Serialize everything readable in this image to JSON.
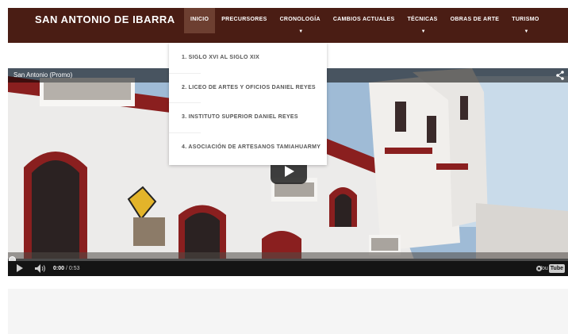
{
  "header": {
    "brand": "SAN ANTONIO DE IBARRA",
    "nav": [
      {
        "label": "INICIO",
        "active": true,
        "dropdown": false
      },
      {
        "label": "PRECURSORES",
        "active": false,
        "dropdown": false
      },
      {
        "label": "CRONOLOGÍA",
        "active": false,
        "dropdown": true
      },
      {
        "label": "CAMBIOS ACTUALES",
        "active": false,
        "dropdown": false
      },
      {
        "label": "TÉCNICAS",
        "active": false,
        "dropdown": true
      },
      {
        "label": "OBRAS DE ARTE",
        "active": false,
        "dropdown": false
      },
      {
        "label": "TURISMO",
        "active": false,
        "dropdown": true
      }
    ]
  },
  "dropdown": {
    "items": [
      "1. SIGLO XVI AL SIGLO XIX",
      "2. LICEO DE ARTES Y OFICIOS DANIEL REYES",
      "3. INSTITUTO SUPERIOR DANIEL REYES",
      "4. ASOCIACIÓN DE ARTESANOS TAMIAHUARMY"
    ]
  },
  "video": {
    "title": "San Antonio (Promo)",
    "current_time": "0:00",
    "duration": "/ 0:53",
    "progress": 0,
    "logo": "You",
    "logo_tube": "Tube",
    "icons": [
      "share-icon",
      "play-icon",
      "volume-icon",
      "gear-icon"
    ]
  },
  "colors": {
    "navbar": "#4a1d14",
    "nav_active": "#6d3f31",
    "building_red": "#8a1f1f",
    "sky": "#bcd3e6"
  }
}
